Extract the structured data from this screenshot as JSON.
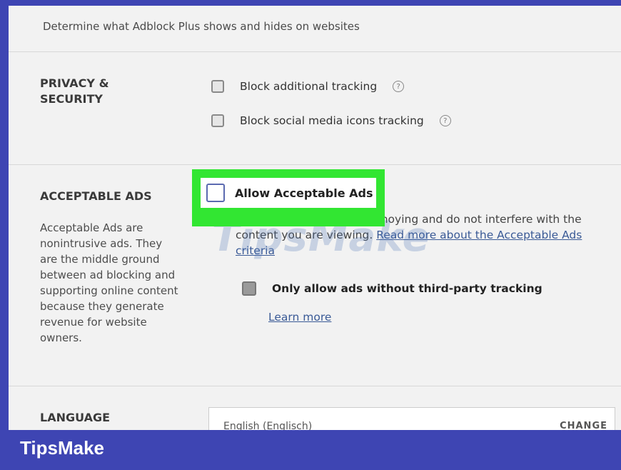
{
  "intro_text": "Determine what Adblock Plus shows and hides on websites",
  "privacy": {
    "heading": "PRIVACY & SECURITY",
    "options": [
      {
        "label": "Block additional tracking",
        "checked": false,
        "help": "?"
      },
      {
        "label": "Block social media icons tracking",
        "checked": false,
        "help": "?"
      }
    ]
  },
  "acceptable_ads": {
    "heading": "ACCEPTABLE ADS",
    "description": "Acceptable Ads are nonintrusive ads. They are the middle ground between ad blocking and supporting online content because they generate revenue for website owners.",
    "allow_label": "Allow Acceptable Ads",
    "allow_checked": false,
    "info_text": "Acceptable Ads are not annoying and do not interfere with the content you are viewing.",
    "read_more_link": "Read more about the Acceptable Ads criteria",
    "sub_option_label": "Only allow ads without third-party tracking",
    "sub_option_checked": false,
    "learn_more": "Learn more",
    "highlight_color": "#32e632"
  },
  "language": {
    "heading": "LANGUAGE",
    "value": "English (Englisch)",
    "change_label": "CHANGE"
  },
  "footer": {
    "brand": "TipsMake",
    "bar_color": "#3e45b3"
  },
  "watermark": "TipsMake"
}
